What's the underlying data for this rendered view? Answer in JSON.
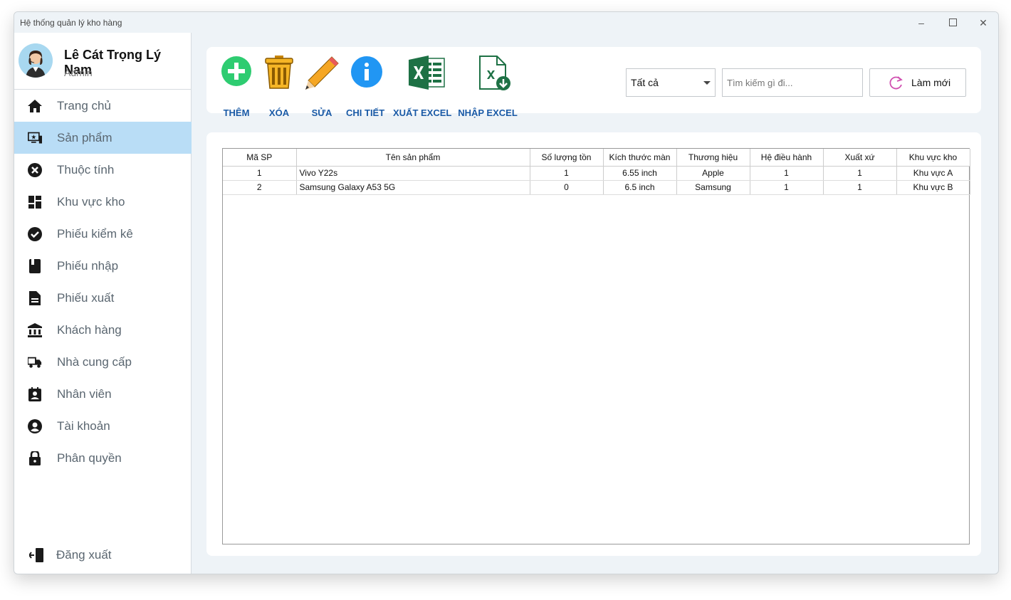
{
  "window": {
    "title": "Hệ thống quản lý kho hàng"
  },
  "user": {
    "name": "Lê Cát Trọng Lý Nam",
    "role": "Admin"
  },
  "sidebar": {
    "items": [
      {
        "label": "Trang chủ",
        "icon": "home-icon"
      },
      {
        "label": "Sản phẩm",
        "icon": "product-icon",
        "active": true
      },
      {
        "label": "Thuộc tính",
        "icon": "attribute-icon"
      },
      {
        "label": "Khu vực kho",
        "icon": "warehouse-area-icon"
      },
      {
        "label": "Phiếu kiểm kê",
        "icon": "check-circle-icon"
      },
      {
        "label": "Phiếu nhập",
        "icon": "book-icon"
      },
      {
        "label": "Phiếu xuất",
        "icon": "document-icon"
      },
      {
        "label": "Khách hàng",
        "icon": "bank-icon"
      },
      {
        "label": "Nhà cung cấp",
        "icon": "truck-icon"
      },
      {
        "label": "Nhân viên",
        "icon": "badge-icon"
      },
      {
        "label": "Tài khoản",
        "icon": "account-icon"
      },
      {
        "label": "Phân quyền",
        "icon": "lock-icon"
      }
    ],
    "logout": "Đăng xuất"
  },
  "toolbar": {
    "add": "THÊM",
    "delete": "XÓA",
    "edit": "SỬA",
    "detail": "CHI TIẾT",
    "export_excel": "XUẤT EXCEL",
    "import_excel": "NHẬP EXCEL",
    "filter_value": "Tất cả",
    "search_placeholder": "Tìm kiếm gì đi...",
    "refresh": "Làm mới"
  },
  "table": {
    "headers": [
      "Mã SP",
      "Tên sản phẩm",
      "Số lượng tồn",
      "Kích thước màn",
      "Thương hiệu",
      "Hệ điều hành",
      "Xuất xứ",
      "Khu vực kho"
    ],
    "rows": [
      [
        "1",
        "Vivo Y22s",
        "1",
        "6.55 inch",
        "Apple",
        "1",
        "1",
        "Khu vực A"
      ],
      [
        "2",
        "Samsung Galaxy A53 5G",
        "0",
        "6.5 inch",
        "Samsung",
        "1",
        "1",
        "Khu vực B"
      ]
    ]
  },
  "colors": {
    "accent": "#1a5aa6",
    "active_nav": "#b9ddf6",
    "add_green": "#2ecc71",
    "info_blue": "#2196f3",
    "excel_green": "#1e7145"
  }
}
